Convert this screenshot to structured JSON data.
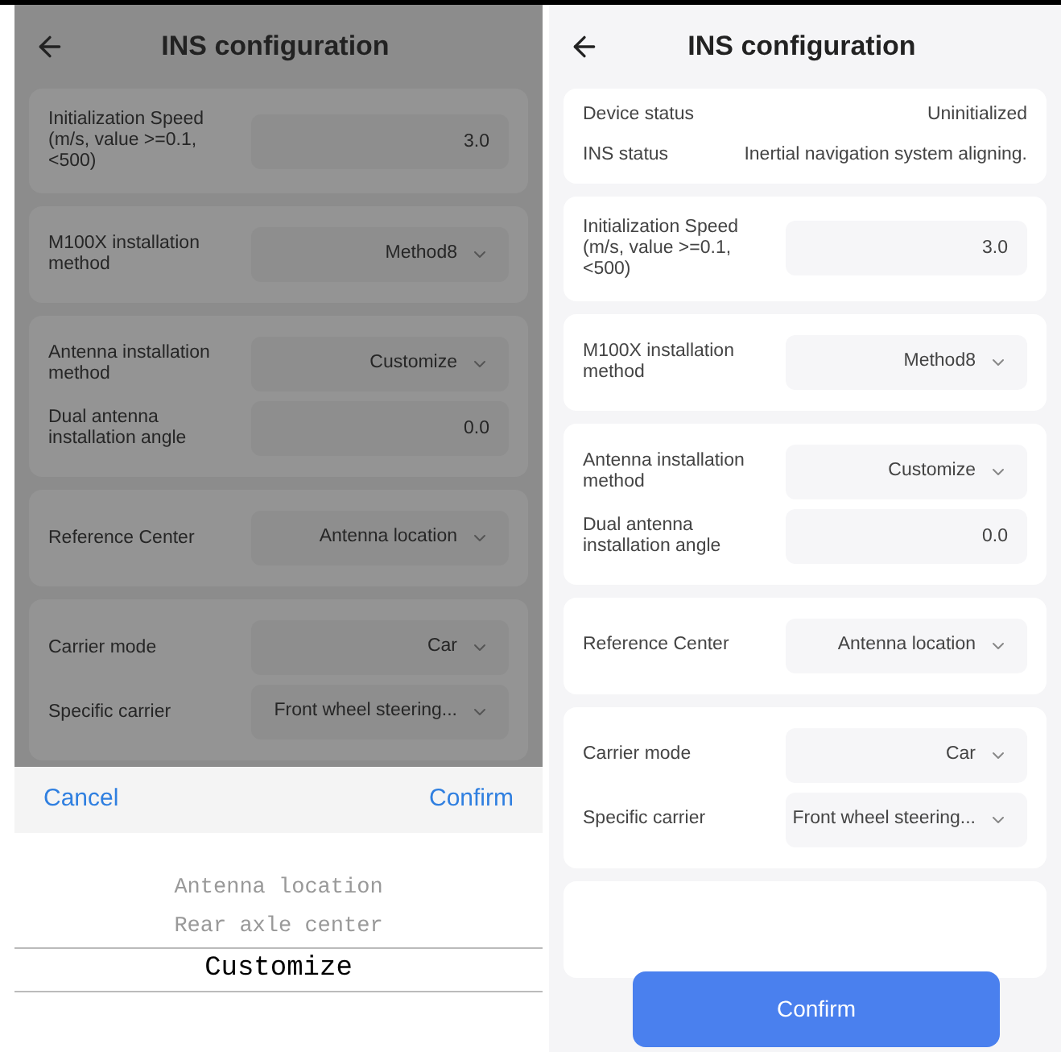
{
  "screens": [
    {
      "dimmed": true,
      "title": "INS configuration",
      "sections": [
        {
          "rows": [
            {
              "kind": "input",
              "label": "Initialization Speed (m/s, value >=0.1, <500)",
              "value": "3.0"
            }
          ]
        },
        {
          "rows": [
            {
              "kind": "select",
              "label": "M100X installation method",
              "value": "Method8"
            }
          ]
        },
        {
          "rows": [
            {
              "kind": "select",
              "label": "Antenna installation method",
              "value": "Customize"
            },
            {
              "kind": "input",
              "label": "Dual antenna installation angle",
              "value": "0.0"
            }
          ]
        },
        {
          "rows": [
            {
              "kind": "select",
              "label": "Reference Center",
              "value": "Antenna location"
            }
          ]
        },
        {
          "rows": [
            {
              "kind": "select",
              "label": "Carrier mode",
              "value": "Car"
            },
            {
              "kind": "select",
              "label": "Specific carrier",
              "value": "Front wheel steering..."
            }
          ]
        }
      ],
      "picker": {
        "cancel": "Cancel",
        "confirm": "Confirm",
        "options": [
          {
            "label": "Antenna location",
            "selected": false
          },
          {
            "label": "Rear axle center",
            "selected": false
          },
          {
            "label": "Customize",
            "selected": true
          }
        ]
      }
    },
    {
      "dimmed": false,
      "title": "INS configuration",
      "status": [
        {
          "label": "Device status",
          "value": "Uninitialized"
        },
        {
          "label": "INS status",
          "value": "Inertial navigation system aligning."
        }
      ],
      "sections": [
        {
          "rows": [
            {
              "kind": "input",
              "label": "Initialization Speed (m/s, value >=0.1, <500)",
              "value": "3.0"
            }
          ]
        },
        {
          "rows": [
            {
              "kind": "select",
              "label": "M100X installation method",
              "value": "Method8"
            }
          ]
        },
        {
          "rows": [
            {
              "kind": "select",
              "label": "Antenna installation method",
              "value": "Customize"
            },
            {
              "kind": "input",
              "label": "Dual antenna installation angle",
              "value": "0.0"
            }
          ]
        },
        {
          "rows": [
            {
              "kind": "select",
              "label": "Reference Center",
              "value": "Antenna location"
            }
          ]
        },
        {
          "rows": [
            {
              "kind": "select",
              "label": "Carrier mode",
              "value": "Car"
            },
            {
              "kind": "select",
              "label": "Specific carrier",
              "value": "Front wheel steering..."
            }
          ]
        }
      ],
      "confirm_button": "Confirm"
    }
  ]
}
